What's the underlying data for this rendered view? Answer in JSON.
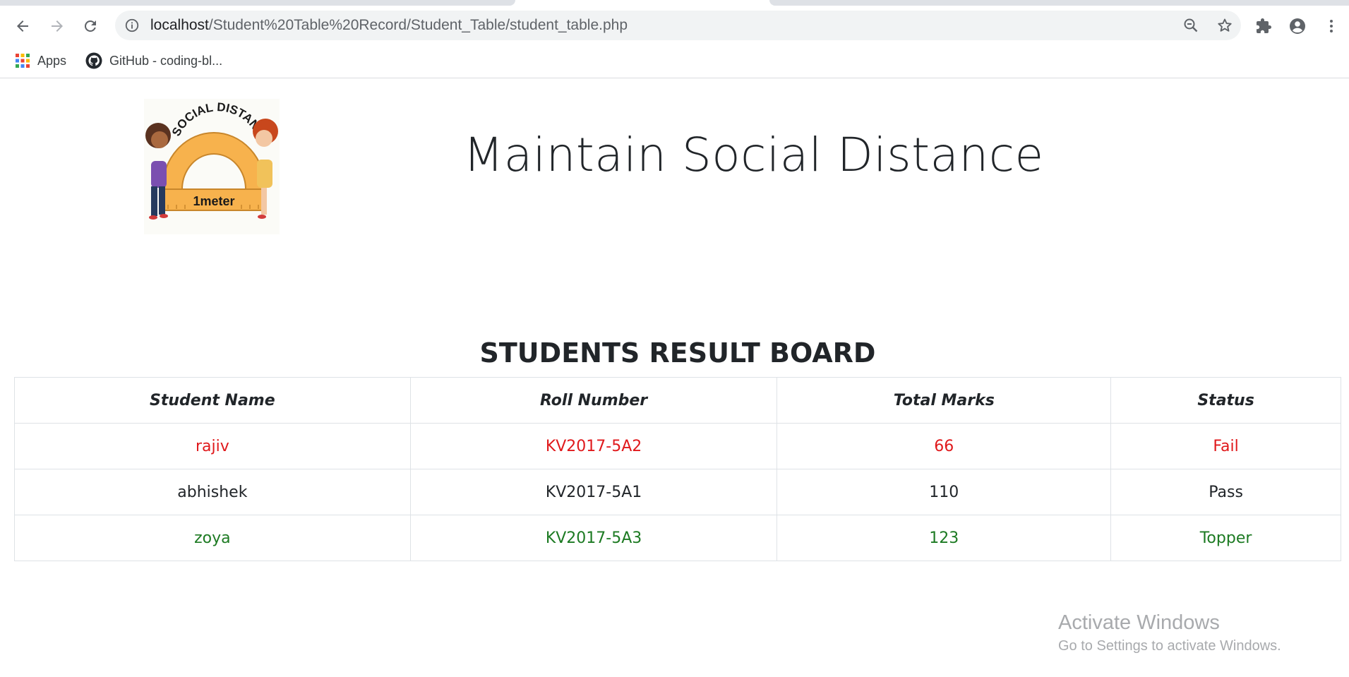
{
  "browser": {
    "url_host": "localhost",
    "url_path": "/Student%20Table%20Record/Student_Table/student_table.php",
    "bookmarks": [
      {
        "label": "Apps",
        "icon": "apps-grid-icon"
      },
      {
        "label": "GitHub - coding-bl...",
        "icon": "github-icon"
      }
    ]
  },
  "page": {
    "logo": {
      "arc_text": "SOCIAL DISTANCING",
      "ruler_text": "1meter"
    },
    "heading": "Maintain Social Distance",
    "board_title": "STUDENTS RESULT BOARD",
    "table": {
      "headers": [
        "Student Name",
        "Roll Number",
        "Total Marks",
        "Status"
      ],
      "rows": [
        {
          "name": "rajiv",
          "roll": "KV2017-5A2",
          "marks": "66",
          "status": "Fail"
        },
        {
          "name": "abhishek",
          "roll": "KV2017-5A1",
          "marks": "110",
          "status": "Pass"
        },
        {
          "name": "zoya",
          "roll": "KV2017-5A3",
          "marks": "123",
          "status": "Topper"
        }
      ]
    }
  },
  "watermark": {
    "title": "Activate Windows",
    "subtitle": "Go to Settings to activate Windows."
  },
  "colors": {
    "fail": "#e0191c",
    "pass": "#212529",
    "topper": "#1c7a22"
  }
}
